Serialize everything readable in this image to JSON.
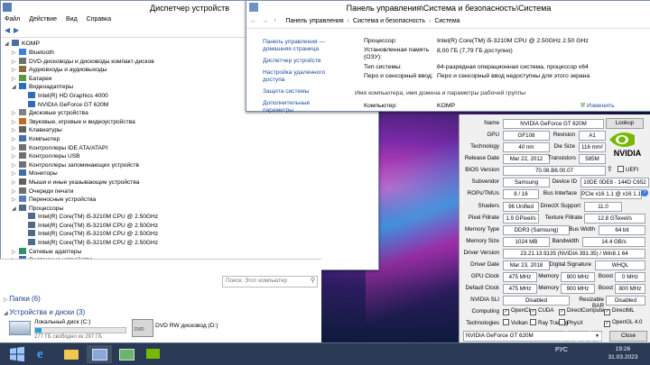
{
  "devmgr": {
    "title": "Диспетчер устройств",
    "menu": [
      "Файл",
      "Действие",
      "Вид",
      "Справка"
    ],
    "root": "KOMP",
    "items": [
      {
        "label": "Bluetooth",
        "indent": 1,
        "expand": "▷"
      },
      {
        "label": "DVD-дисководы и дисководы компакт-дисков",
        "indent": 1,
        "expand": "▷"
      },
      {
        "label": "Аудиовходы и аудиовыходы",
        "indent": 1,
        "expand": "▷"
      },
      {
        "label": "Батареи",
        "indent": 1,
        "expand": "▷"
      },
      {
        "label": "Видеоадаптеры",
        "indent": 1,
        "expand": "◢"
      },
      {
        "label": "Intel(R) HD Graphics 4000",
        "indent": 2,
        "expand": ""
      },
      {
        "label": "NVIDIA GeForce GT 620M",
        "indent": 2,
        "expand": ""
      },
      {
        "label": "Дисковые устройства",
        "indent": 1,
        "expand": "▷"
      },
      {
        "label": "Звуковые, игровые и видеоустройства",
        "indent": 1,
        "expand": "▷"
      },
      {
        "label": "Клавиатуры",
        "indent": 1,
        "expand": "▷"
      },
      {
        "label": "Компьютер",
        "indent": 1,
        "expand": "▷"
      },
      {
        "label": "Контроллеры IDE ATA/ATAPI",
        "indent": 1,
        "expand": "▷"
      },
      {
        "label": "Контроллеры USB",
        "indent": 1,
        "expand": "▷"
      },
      {
        "label": "Контроллеры запоминающих устройств",
        "indent": 1,
        "expand": "▷"
      },
      {
        "label": "Мониторы",
        "indent": 1,
        "expand": "▷"
      },
      {
        "label": "Мыши и иные указывающие устройства",
        "indent": 1,
        "expand": "▷"
      },
      {
        "label": "Очереди печати",
        "indent": 1,
        "expand": "▷"
      },
      {
        "label": "Переносные устройства",
        "indent": 1,
        "expand": "▷"
      },
      {
        "label": "Процессоры",
        "indent": 1,
        "expand": "◢"
      },
      {
        "label": "Intel(R) Core(TM) i5-3210M CPU @ 2.50GHz",
        "indent": 2,
        "expand": ""
      },
      {
        "label": "Intel(R) Core(TM) i5-3210M CPU @ 2.50GHz",
        "indent": 2,
        "expand": ""
      },
      {
        "label": "Intel(R) Core(TM) i5-3210M CPU @ 2.50GHz",
        "indent": 2,
        "expand": ""
      },
      {
        "label": "Intel(R) Core(TM) i5-3210M CPU @ 2.50GHz",
        "indent": 2,
        "expand": ""
      },
      {
        "label": "Сетевые адаптеры",
        "indent": 1,
        "expand": "▷"
      },
      {
        "label": "Системные устройства",
        "indent": 1,
        "expand": "▷"
      }
    ]
  },
  "sysprops": {
    "title": "Панель управления\\Система и безопасность\\Система",
    "breadcrumb": [
      "Панель управления",
      "Система и безопасность",
      "Система"
    ],
    "left": [
      "Панель управления — домашняя страница",
      "Диспетчер устройств",
      "Настройка удаленного доступа",
      "Защита системы",
      "Дополнительные параметры"
    ],
    "rows": [
      {
        "k": "Процессор:",
        "v": "Intel(R) Core(TM) i5-3210M CPU @ 2.50GHz   2.50 GHz"
      },
      {
        "k": "Установленная память (ОЗУ):",
        "v": "8,00 ГБ (7,79 ГБ доступно)"
      },
      {
        "k": "Тип системы:",
        "v": "64-разрядная операционная система, процессор x64"
      },
      {
        "k": "Перо и сенсорный ввод:",
        "v": "Перо и сенсорный ввод недоступны для этого экрана"
      }
    ],
    "group_title": "Имя компьютера, имя домена и параметры рабочей группы",
    "computer_label": "Компьютер:",
    "computer_value": "KOMP",
    "change_label": "Изменить"
  },
  "gpuz": {
    "name_label": "Name",
    "name": "NVIDIA GeForce GT 620M",
    "lookup": "Lookup",
    "gpu_label": "GPU",
    "gpu": "GF108",
    "rev_label": "Revision",
    "rev": "A1",
    "tech_label": "Technology",
    "tech": "40 nm",
    "die_label": "Die Size",
    "die": "116 mm²",
    "release_label": "Release Date",
    "release": "Mar 22, 2012",
    "trans_label": "Transistors",
    "trans": "585M",
    "bios_label": "BIOS Version",
    "bios": "70.08.B6.00.07",
    "uefi": "UEFI",
    "subv_label": "Subvendor",
    "subv": "Samsung",
    "devid_label": "Device ID",
    "devid": "10DE 0DE8 - 144D C652",
    "rops_label": "ROPs/TMUs",
    "rops": "8 / 16",
    "bus_label": "Bus Interface",
    "bus": "PCIe x16 1.1 @ x16 1.1",
    "shaders_label": "Shaders",
    "shaders": "96 Unified",
    "dx_label": "DirectX Support",
    "dx": "11.0",
    "pix_label": "Pixel Fillrate",
    "pix": "1.9 GPixel/s",
    "tex_label": "Texture Fillrate",
    "tex": "12.8 GTexel/s",
    "memtype_label": "Memory Type",
    "memtype": "DDR3 (Samsung)",
    "bw_label": "Bus Width",
    "bw": "64 bit",
    "memsize_label": "Memory Size",
    "memsize": "1024 MB",
    "band_label": "Bandwidth",
    "band": "14.4 GB/s",
    "drv_label": "Driver Version",
    "drv": "23.21.13.9135 (NVIDIA 391.35) / Win8.1 64",
    "drvdate_label": "Driver Date",
    "drvdate": "Mar 23, 2018",
    "sig_label": "Digital Signature",
    "sig": "WHQL",
    "gpuclk_label": "GPU Clock",
    "gpuclk": "475 MHz",
    "mem1_label": "Memory",
    "mem1": "900 MHz",
    "boost1_label": "Boost",
    "boost1": "0 MHz",
    "defclk_label": "Default Clock",
    "defclk": "475 MHz",
    "mem2_label": "Memory",
    "mem2": "900 MHz",
    "boost2_label": "Boost",
    "boost2": "800 MHz",
    "sli_label": "NVIDIA SLI",
    "sli": "Disabled",
    "rbar_label": "Resizable BAR",
    "rbar": "Disabled",
    "comp_label": "Computing",
    "comp": [
      "OpenCL",
      "CUDA",
      "DirectCompute",
      "DirectML"
    ],
    "techs_label": "Technologies",
    "techs": [
      "Vulkan",
      "Ray Tracing",
      "PhysX",
      "OpenGL 4.0"
    ],
    "bottom": "NVIDIA GeForce GT 620M",
    "close": "Close",
    "logo": "NVIDIA"
  },
  "explorer": {
    "search_placeholder": "Поиск: Этот компьютер",
    "folders": "Папки (6)",
    "devices": "Устройства и диски (3)",
    "disk_c": "Локальный диск (C:)",
    "disk_c_free": "277 ГБ свободно из 297 ГБ",
    "disk_c_used": 0.067,
    "dvd": "DVD RW дисковод (D:)"
  },
  "taskbar": {
    "lang": "РУС",
    "time": "19:26",
    "date": "31.03.2023"
  },
  "watermark": "Avito"
}
